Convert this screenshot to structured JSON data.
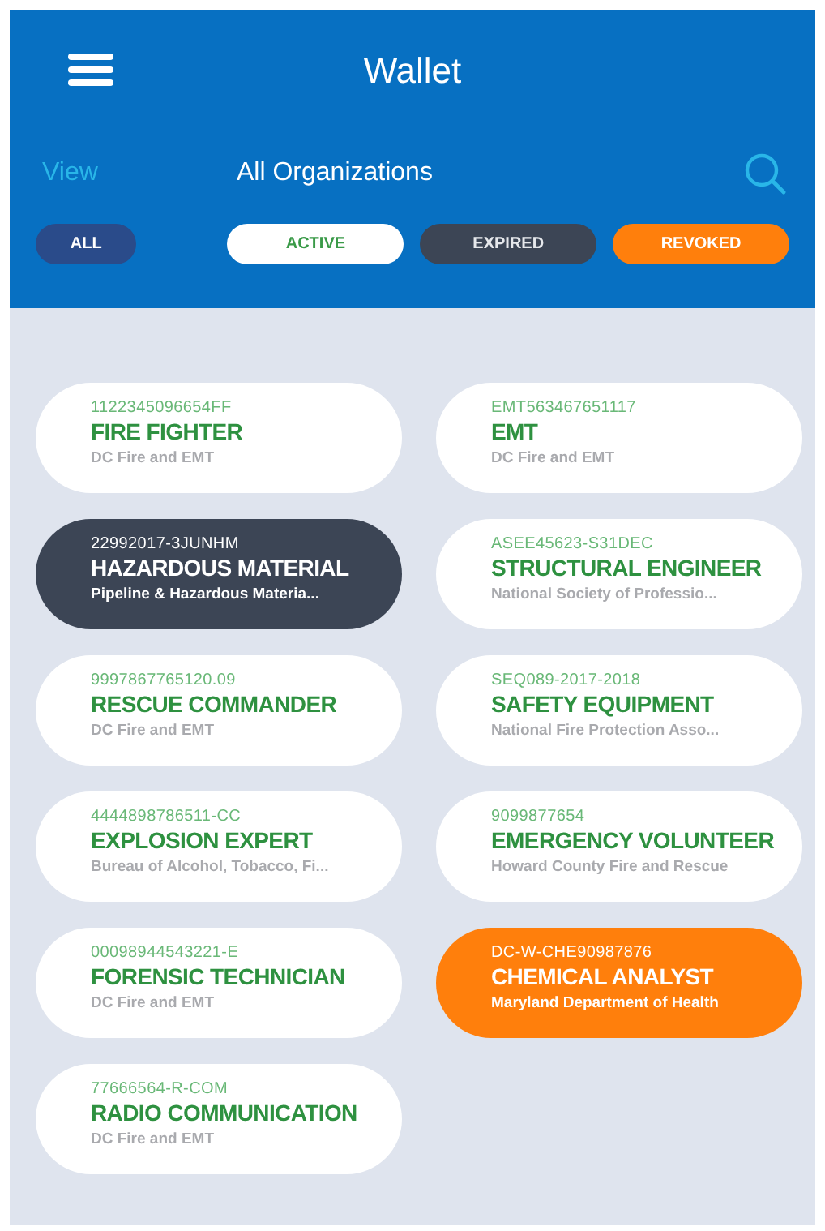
{
  "header": {
    "title": "Wallet",
    "view_label": "View",
    "organization": "All Organizations"
  },
  "filters": [
    {
      "label": "ALL",
      "kind": "all"
    },
    {
      "label": "ACTIVE",
      "kind": "active"
    },
    {
      "label": "EXPIRED",
      "kind": "expired"
    },
    {
      "label": "REVOKED",
      "kind": "revoked"
    }
  ],
  "credentials": [
    {
      "code": "1122345096654FF",
      "title": "FIRE FIGHTER",
      "issuer": "DC Fire and EMT",
      "kind": "active"
    },
    {
      "code": "EMT563467651117",
      "title": "EMT",
      "issuer": "DC Fire and EMT",
      "kind": "active"
    },
    {
      "code": "22992017-3JUNHM",
      "title": "HAZARDOUS MATERIAL",
      "issuer": "Pipeline & Hazardous Materia...",
      "kind": "expired"
    },
    {
      "code": "ASEE45623-S31DEC",
      "title": "STRUCTURAL ENGINEER",
      "issuer": "National Society of Professio...",
      "kind": "active"
    },
    {
      "code": "9997867765120.09",
      "title": "RESCUE COMMANDER",
      "issuer": "DC Fire and EMT",
      "kind": "active"
    },
    {
      "code": "SEQ089-2017-2018",
      "title": "SAFETY EQUIPMENT",
      "issuer": "National Fire Protection Asso...",
      "kind": "active"
    },
    {
      "code": "4444898786511-CC",
      "title": "EXPLOSION EXPERT",
      "issuer": "Bureau of Alcohol, Tobacco, Fi...",
      "kind": "active"
    },
    {
      "code": "9099877654",
      "title": "EMERGENCY VOLUNTEER",
      "issuer": "Howard County Fire and Rescue",
      "kind": "active"
    },
    {
      "code": "00098944543221-E",
      "title": "FORENSIC TECHNICIAN",
      "issuer": "DC Fire and EMT",
      "kind": "active"
    },
    {
      "code": "DC-W-CHE90987876",
      "title": "CHEMICAL ANALYST",
      "issuer": "Maryland Department of Health",
      "kind": "revoked"
    },
    {
      "code": "77666564-R-COM",
      "title": "RADIO COMMUNICATION",
      "issuer": "DC Fire and EMT",
      "kind": "active"
    }
  ]
}
